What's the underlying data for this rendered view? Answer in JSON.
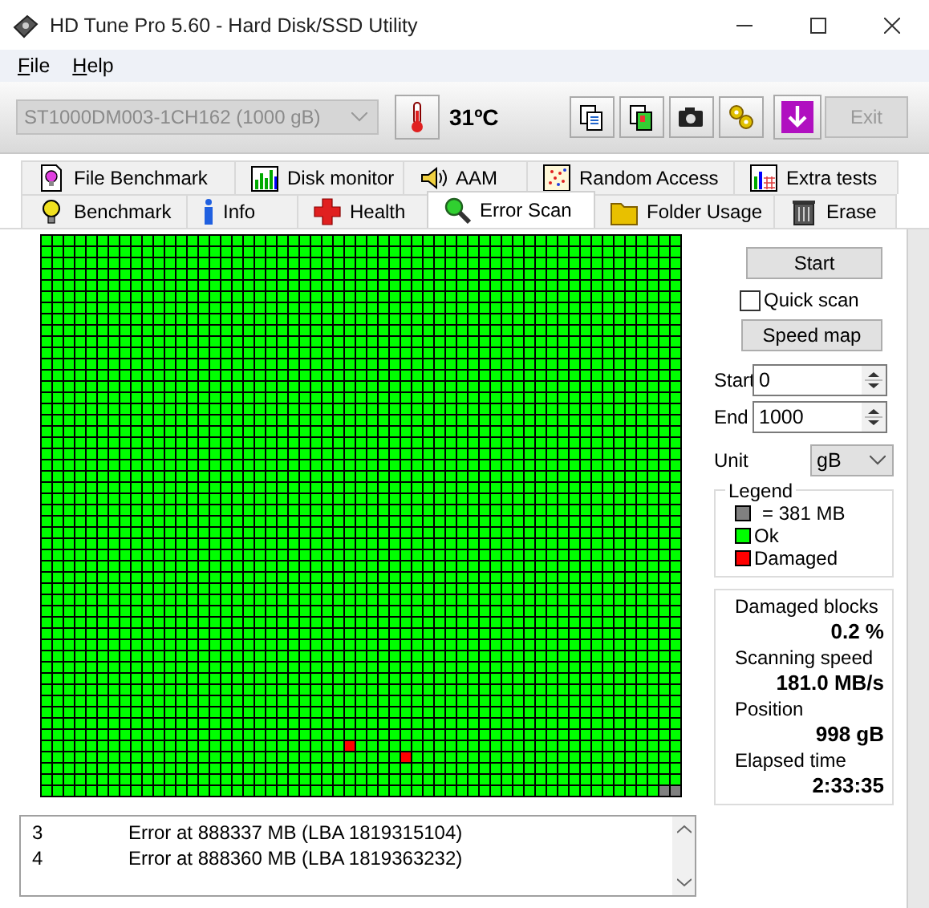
{
  "window": {
    "title": "HD Tune Pro 5.60 - Hard Disk/SSD Utility"
  },
  "menu": [
    {
      "label": "File"
    },
    {
      "label": "Help"
    }
  ],
  "toolbar": {
    "drive": "ST1000DM003-1CH162 (1000 gB)",
    "drive_disabled": true,
    "temperature": "31ºC",
    "exit": "Exit",
    "exit_disabled": true
  },
  "tab_rows": [
    {
      "tabs": [
        {
          "label": "File Benchmark",
          "selected": false
        },
        {
          "label": "Disk monitor",
          "selected": false
        },
        {
          "label": "AAM",
          "selected": false
        },
        {
          "label": "Random Access",
          "selected": false
        },
        {
          "label": "Extra tests",
          "selected": false
        }
      ]
    },
    {
      "tabs": [
        {
          "label": "Benchmark",
          "selected": false
        },
        {
          "label": "Info",
          "selected": false
        },
        {
          "label": "Health",
          "selected": false
        },
        {
          "label": "Error Scan",
          "selected": true
        },
        {
          "label": "Folder Usage",
          "selected": false
        },
        {
          "label": "Erase",
          "selected": false
        }
      ]
    }
  ],
  "controls": {
    "start_button": "Start",
    "quick_scan": {
      "label": "Quick scan",
      "checked": false
    },
    "speed_map_button": "Speed map",
    "start": {
      "label": "Start",
      "value": "0"
    },
    "end": {
      "label": "End",
      "value": "1000"
    },
    "unit": {
      "label": "Unit",
      "value": "gB"
    }
  },
  "legend": {
    "title": "Legend",
    "items": [
      {
        "label": "= 381 MB",
        "color": "#808080"
      },
      {
        "label": "Ok",
        "color": "#00ff00"
      },
      {
        "label": "Damaged",
        "color": "#ff0000"
      }
    ]
  },
  "stats": [
    {
      "label": "Damaged blocks",
      "value": "0.2 %"
    },
    {
      "label": "Scanning speed",
      "value": "181.0 MB/s"
    },
    {
      "label": "Position",
      "value": "998 gB"
    },
    {
      "label": "Elapsed time",
      "value": "2:33:35"
    }
  ],
  "log": [
    {
      "number": "3",
      "text": "Error at 888337 MB (LBA 1819315104)"
    },
    {
      "number": "4",
      "text": "Error at 888360 MB (LBA 1819363232)"
    }
  ]
}
